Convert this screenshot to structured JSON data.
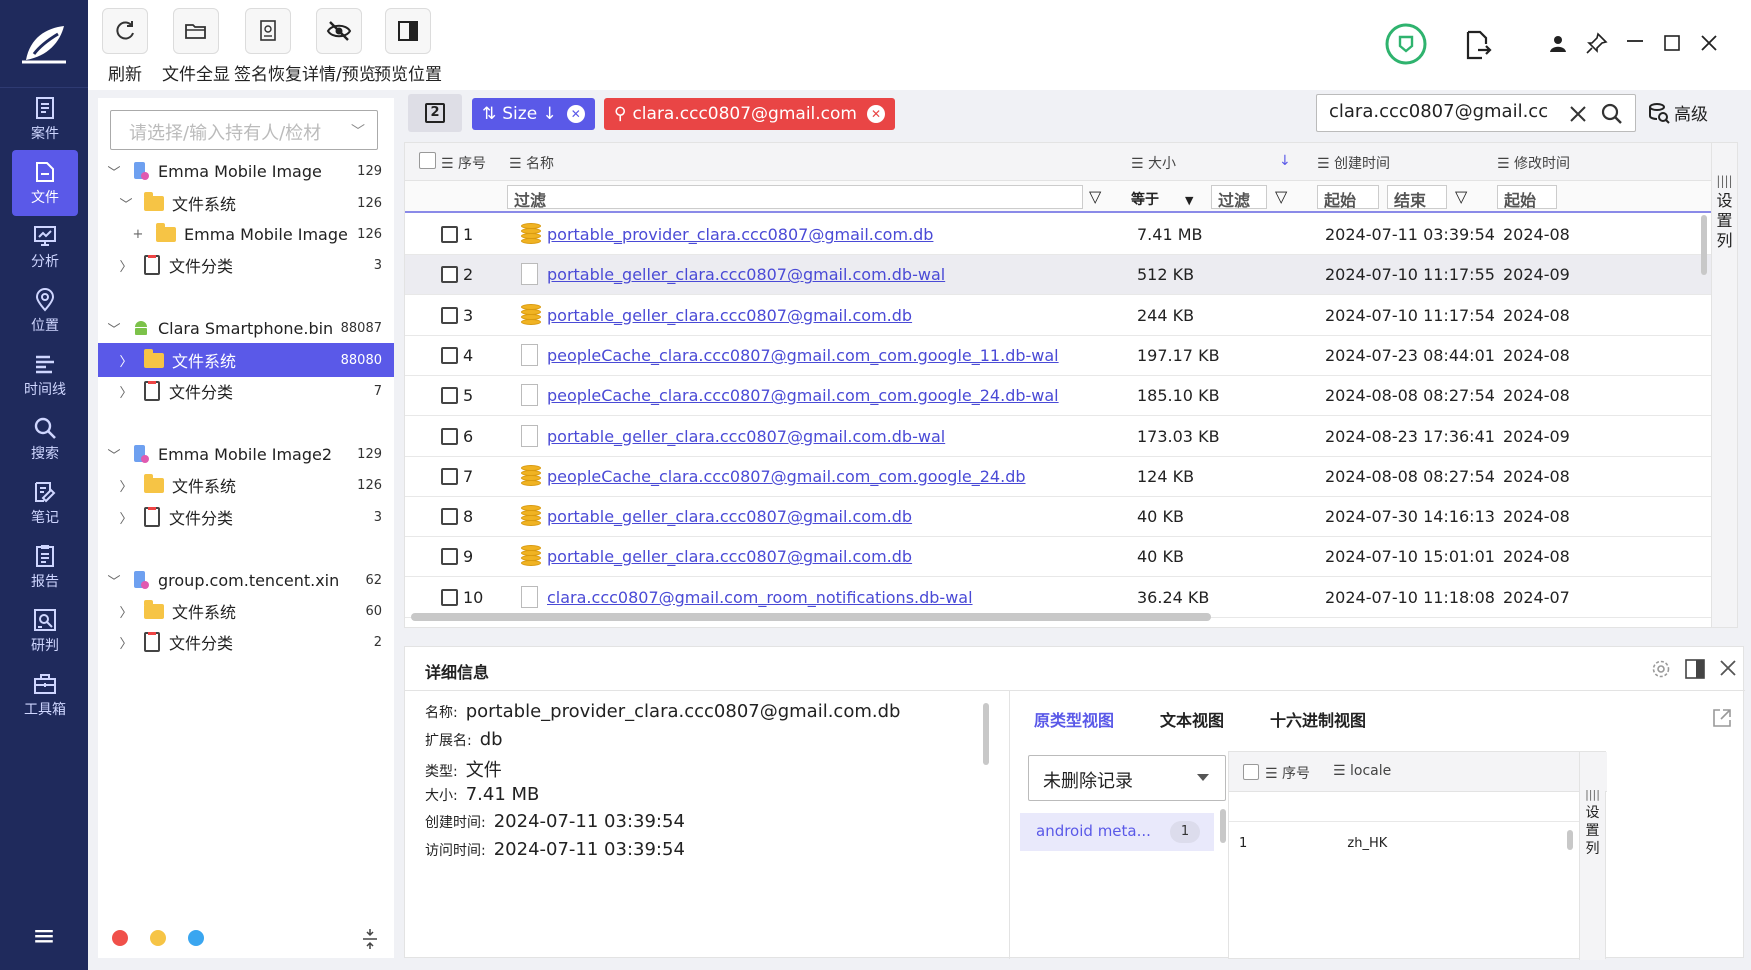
{
  "nav": {
    "items": [
      {
        "label": "案件",
        "icon": "case-icon"
      },
      {
        "label": "文件",
        "icon": "file-icon"
      },
      {
        "label": "分析",
        "icon": "analysis-icon"
      },
      {
        "label": "位置",
        "icon": "location-icon"
      },
      {
        "label": "时间线",
        "icon": "timeline-icon"
      },
      {
        "label": "搜索",
        "icon": "search-icon"
      },
      {
        "label": "笔记",
        "icon": "notes-icon"
      },
      {
        "label": "报告",
        "icon": "report-icon"
      },
      {
        "label": "研判",
        "icon": "judge-icon"
      },
      {
        "label": "工具箱",
        "icon": "toolbox-icon"
      }
    ],
    "active_index": 1
  },
  "toolbar": {
    "buttons": [
      {
        "label": "刷新",
        "icon": "refresh-icon"
      },
      {
        "label": "文件全显",
        "icon": "folder-open-icon"
      },
      {
        "label": "签名恢复",
        "icon": "signature-restore-icon"
      },
      {
        "label": "详情/预览",
        "icon": "eye-off-icon"
      },
      {
        "label": "预览位置",
        "icon": "preview-position-icon"
      }
    ]
  },
  "tree": {
    "placeholder": "请选择/输入持有人/检材",
    "rows": [
      {
        "level": 0,
        "kind": "device",
        "label": "Emma Mobile Image",
        "count": "129",
        "arrow": "v"
      },
      {
        "level": 1,
        "kind": "folder",
        "label": "文件系统",
        "count": "126",
        "arrow": "v"
      },
      {
        "level": 2,
        "kind": "folder",
        "label": "Emma Mobile Image",
        "count": "126",
        "arrow": "+"
      },
      {
        "level": 1,
        "kind": "doc",
        "label": "文件分类",
        "count": "3",
        "arrow": ">"
      },
      {
        "level": 0,
        "kind": "android",
        "label": "Clara Smartphone.bin",
        "count": "88087",
        "arrow": "v"
      },
      {
        "level": 1,
        "kind": "folder",
        "label": "文件系统",
        "count": "88080",
        "arrow": ">",
        "selected": true
      },
      {
        "level": 1,
        "kind": "doc",
        "label": "文件分类",
        "count": "7",
        "arrow": ">"
      },
      {
        "level": 0,
        "kind": "device",
        "label": "Emma Mobile Image2",
        "count": "129",
        "arrow": "v"
      },
      {
        "level": 1,
        "kind": "folder",
        "label": "文件系统",
        "count": "126",
        "arrow": ">"
      },
      {
        "level": 1,
        "kind": "doc",
        "label": "文件分类",
        "count": "3",
        "arrow": ">"
      },
      {
        "level": 0,
        "kind": "device",
        "label": "group.com.tencent.xin",
        "count": "62",
        "arrow": "v"
      },
      {
        "level": 1,
        "kind": "folder",
        "label": "文件系统",
        "count": "60",
        "arrow": ">"
      },
      {
        "level": 1,
        "kind": "doc",
        "label": "文件分类",
        "count": "2",
        "arrow": ">"
      }
    ]
  },
  "filters": {
    "panel_toggle": "2",
    "size_chip": "Size ↓",
    "query_chip": "clara.ccc0807@gmail.com",
    "search_value": "clara.ccc0807@gmail.cc",
    "advanced": "高级"
  },
  "grid": {
    "columns": {
      "index": "序号",
      "name": "名称",
      "size": "大小",
      "created": "创建时间",
      "modified": "修改时间"
    },
    "filter_row": {
      "name": "过滤",
      "size_op": "等于",
      "size": "过滤",
      "created_from": "起始",
      "created_to": "结束",
      "modified_from": "起始"
    },
    "settings": "设置列",
    "rows": [
      {
        "n": "1",
        "type": "db",
        "name": "portable_provider_clara.ccc0807@gmail.com.db",
        "size": "7.41 MB",
        "created": "2024-07-11 03:39:54",
        "modified": "2024-08"
      },
      {
        "n": "2",
        "type": "file",
        "name": "portable_geller_clara.ccc0807@gmail.com.db-wal",
        "size": "512 KB",
        "created": "2024-07-10 11:17:55",
        "modified": "2024-09"
      },
      {
        "n": "3",
        "type": "db",
        "name": "portable_geller_clara.ccc0807@gmail.com.db",
        "size": "244 KB",
        "created": "2024-07-10 11:17:54",
        "modified": "2024-08"
      },
      {
        "n": "4",
        "type": "file",
        "name": "peopleCache_clara.ccc0807@gmail.com_com.google_11.db-wal",
        "size": "197.17 KB",
        "created": "2024-07-23 08:44:01",
        "modified": "2024-08"
      },
      {
        "n": "5",
        "type": "file",
        "name": "peopleCache_clara.ccc0807@gmail.com_com.google_24.db-wal",
        "size": "185.10 KB",
        "created": "2024-08-08 08:27:54",
        "modified": "2024-08"
      },
      {
        "n": "6",
        "type": "file",
        "name": "portable_geller_clara.ccc0807@gmail.com.db-wal",
        "size": "173.03 KB",
        "created": "2024-08-23 17:36:41",
        "modified": "2024-09"
      },
      {
        "n": "7",
        "type": "db",
        "name": "peopleCache_clara.ccc0807@gmail.com_com.google_24.db",
        "size": "124 KB",
        "created": "2024-08-08 08:27:54",
        "modified": "2024-08"
      },
      {
        "n": "8",
        "type": "db",
        "name": "portable_geller_clara.ccc0807@gmail.com.db",
        "size": "40 KB",
        "created": "2024-07-30 14:16:13",
        "modified": "2024-08"
      },
      {
        "n": "9",
        "type": "db",
        "name": "portable_geller_clara.ccc0807@gmail.com.db",
        "size": "40 KB",
        "created": "2024-07-10 15:01:01",
        "modified": "2024-08"
      },
      {
        "n": "10",
        "type": "file",
        "name": "clara.ccc0807@gmail.com_room_notifications.db-wal",
        "size": "36.24 KB",
        "created": "2024-07-10 11:18:08",
        "modified": "2024-07"
      }
    ]
  },
  "detail": {
    "title": "详细信息",
    "fields": [
      {
        "k": "名称:",
        "v": "portable_provider_clara.ccc0807@gmail.com.db"
      },
      {
        "k": "扩展名:",
        "v": "db"
      },
      {
        "k": "类型:",
        "v": "文件"
      },
      {
        "k": "大小:",
        "v": "7.41 MB"
      },
      {
        "k": "创建时间:",
        "v": "2024-07-11 03:39:54"
      },
      {
        "k": "访问时间:",
        "v": "2024-07-11 03:39:54"
      }
    ],
    "tabs": [
      "原类型视图",
      "文本视图",
      "十六进制视图"
    ],
    "record_select": "未删除记录",
    "meta_item": "android meta...",
    "meta_count": "1",
    "subgrid": {
      "index": "序号",
      "locale": "locale",
      "settings": "设置列",
      "row1_n": "1",
      "row1_locale": "zh_HK"
    }
  },
  "colors": {
    "nav_bg": "#1f2a5c",
    "accent": "#5a59e8",
    "red_chip": "#e94545",
    "link": "#4a4ad6"
  }
}
